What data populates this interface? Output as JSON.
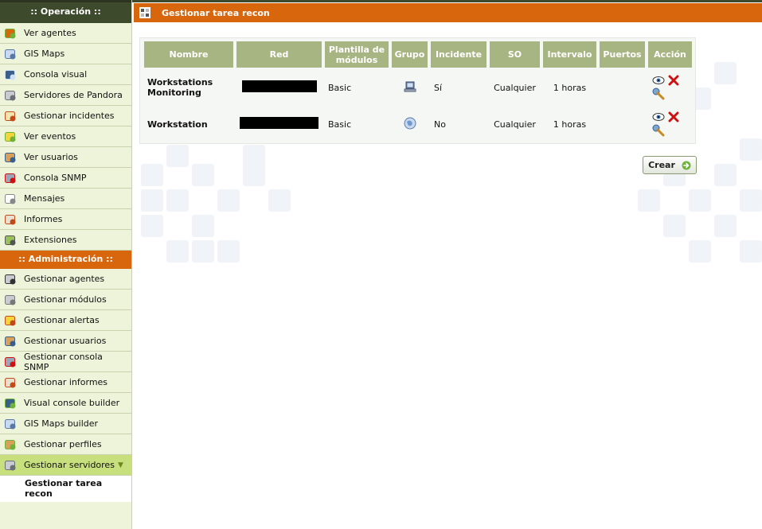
{
  "sidebar": {
    "operacion_header": ":: Operación ::",
    "operacion_items": [
      {
        "label": "Ver agentes",
        "icon": "agents-icon"
      },
      {
        "label": "GIS Maps",
        "icon": "globe-icon"
      },
      {
        "label": "Consola visual",
        "icon": "monitor-icon"
      },
      {
        "label": "Servidores de Pandora",
        "icon": "server-icon"
      },
      {
        "label": "Gestionar incidentes",
        "icon": "incident-icon"
      },
      {
        "label": "Ver eventos",
        "icon": "events-icon"
      },
      {
        "label": "Ver usuarios",
        "icon": "users-icon"
      },
      {
        "label": "Consola SNMP",
        "icon": "snmp-icon"
      },
      {
        "label": "Mensajes",
        "icon": "envelope-icon"
      },
      {
        "label": "Informes",
        "icon": "reports-icon"
      },
      {
        "label": "Extensiones",
        "icon": "extensions-icon"
      }
    ],
    "admin_header": ":: Administración ::",
    "admin_items": [
      {
        "label": "Gestionar agentes",
        "icon": "manage-agents-icon"
      },
      {
        "label": "Gestionar módulos",
        "icon": "modules-icon"
      },
      {
        "label": "Gestionar alertas",
        "icon": "alerts-icon"
      },
      {
        "label": "Gestionar usuarios",
        "icon": "manage-users-icon"
      },
      {
        "label": "Gestionar consola SNMP",
        "icon": "snmp-icon"
      },
      {
        "label": "Gestionar informes",
        "icon": "reports-icon"
      },
      {
        "label": "Visual console builder",
        "icon": "console-builder-icon"
      },
      {
        "label": "GIS Maps builder",
        "icon": "globe-icon"
      },
      {
        "label": "Gestionar perfiles",
        "icon": "profiles-icon"
      },
      {
        "label": "Gestionar servidores",
        "icon": "server-icon"
      }
    ],
    "sub_item": "Gestionar tarea recon"
  },
  "title": "Gestionar tarea recon",
  "table": {
    "headers": [
      "Nombre",
      "Red",
      "Plantilla de módulos",
      "Grupo",
      "Incidente",
      "SO",
      "Intervalo",
      "Puertos",
      "Acción"
    ],
    "rows": [
      {
        "nombre": "Workstations Monitoring",
        "plantilla": "Basic",
        "grupo_icon": "computer-group-icon",
        "incidente": "Sí",
        "so": "Cualquier",
        "intervalo": "1 horas",
        "puertos": ""
      },
      {
        "nombre": "Workstation",
        "plantilla": "Basic",
        "grupo_icon": "globe-group-icon",
        "incidente": "No",
        "so": "Cualquier",
        "intervalo": "1 horas",
        "puertos": ""
      }
    ]
  },
  "crear_label": "Crear",
  "colors": {
    "orange": "#d8660c",
    "dark_green": "#3e4a2c",
    "header_green": "#a7b582",
    "sidebar_bg": "#eef4d9",
    "active_item": "#c7e07d"
  }
}
